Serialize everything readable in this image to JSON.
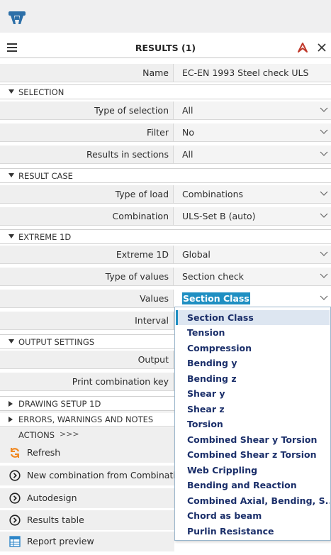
{
  "app": {
    "logo": "scia-logo-icon"
  },
  "header": {
    "title": "RESULTS (1)",
    "pin_icon": "pin-icon",
    "close_icon": "close-icon"
  },
  "name_row": {
    "label": "Name",
    "value": "EC-EN 1993 Steel check ULS"
  },
  "sections": {
    "selection": {
      "title": "SELECTION",
      "rows": [
        {
          "label": "Type of selection",
          "value": "All"
        },
        {
          "label": "Filter",
          "value": "No"
        },
        {
          "label": "Results in sections",
          "value": "All"
        }
      ]
    },
    "result_case": {
      "title": "RESULT CASE",
      "rows": [
        {
          "label": "Type of load",
          "value": "Combinations"
        },
        {
          "label": "Combination",
          "value": "ULS-Set B (auto)"
        }
      ]
    },
    "extreme_1d": {
      "title": "EXTREME 1D",
      "rows": [
        {
          "label": "Extreme 1D",
          "value": "Global"
        },
        {
          "label": "Type of values",
          "value": "Section check"
        },
        {
          "label": "Values",
          "value": "Section Class"
        },
        {
          "label": "Interval",
          "value": ""
        }
      ]
    },
    "output_settings": {
      "title": "OUTPUT SETTINGS",
      "rows": [
        {
          "label": "Output",
          "value": ""
        },
        {
          "label": "Print combination key",
          "value": ""
        }
      ]
    },
    "drawing_setup": {
      "title": "DRAWING SETUP 1D"
    },
    "errors": {
      "title": "ERRORS, WARNINGS AND NOTES"
    }
  },
  "actions": {
    "title": "ACTIONS",
    "more": ">>>",
    "items": [
      {
        "label": "Refresh",
        "icon": "refresh-icon"
      },
      {
        "label": "New combination from Combinations",
        "icon": "circle-chevron-icon"
      },
      {
        "label": "Autodesign",
        "icon": "circle-chevron-icon"
      },
      {
        "label": "Results table",
        "icon": "circle-chevron-icon"
      },
      {
        "label": "Report preview",
        "icon": "table-icon"
      }
    ]
  },
  "dropdown": {
    "selected": "Section Class",
    "options": [
      "Section Class",
      "Tension",
      "Compression",
      "Bending y",
      "Bending z",
      "Shear y",
      "Shear z",
      "Torsion",
      "Combined Shear y  Torsion",
      "Combined Shear z  Torsion",
      "Web Crippling",
      "Bending and Reaction",
      "Combined Axial, Bending, S...",
      "Chord as beam",
      "Purlin Resistance"
    ]
  },
  "colors": {
    "accent": "#1f8fc2",
    "pin": "#c0392b",
    "option_text": "#1b2f6a",
    "row_bg": "#efefef"
  }
}
